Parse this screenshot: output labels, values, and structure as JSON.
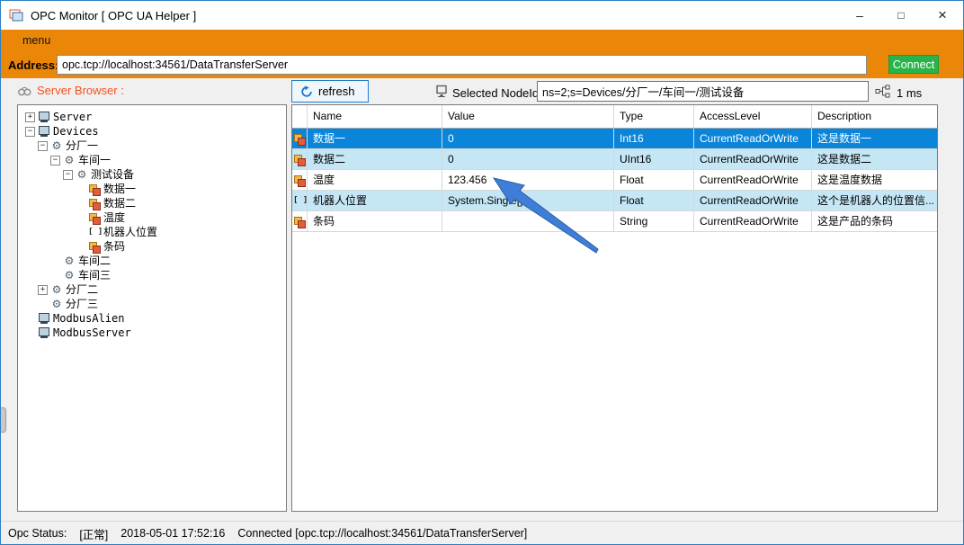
{
  "window": {
    "title": "OPC Monitor [ OPC UA Helper ]"
  },
  "icons": {
    "minimize": "–",
    "maximize": "□",
    "close": "×",
    "expander_collapsed": "+",
    "expander_expanded": "−",
    "gear": "⚙",
    "array": "[ ]"
  },
  "menubar": {
    "menu_label": "menu"
  },
  "address": {
    "label": "Address:",
    "value": "opc.tcp://localhost:34561/DataTransferServer",
    "connect_label": "Connect"
  },
  "browser": {
    "label": "Server Browser :",
    "tree": [
      {
        "label": "Server",
        "level": 0,
        "expander": "plus",
        "icon": "server"
      },
      {
        "label": "Devices",
        "level": 0,
        "expander": "minus",
        "icon": "server"
      },
      {
        "label": "分厂一",
        "level": 1,
        "expander": "minus",
        "icon": "gear"
      },
      {
        "label": "车间一",
        "level": 2,
        "expander": "minus",
        "icon": "gear"
      },
      {
        "label": "测试设备",
        "level": 3,
        "expander": "minus",
        "icon": "gear"
      },
      {
        "label": "数据一",
        "level": 4,
        "expander": "none",
        "icon": "tag"
      },
      {
        "label": "数据二",
        "level": 4,
        "expander": "none",
        "icon": "tag"
      },
      {
        "label": "温度",
        "level": 4,
        "expander": "none",
        "icon": "tag"
      },
      {
        "label": "机器人位置",
        "level": 4,
        "expander": "none",
        "icon": "array"
      },
      {
        "label": "条码",
        "level": 4,
        "expander": "none",
        "icon": "tag"
      },
      {
        "label": "车间二",
        "level": 2,
        "expander": "none",
        "icon": "gear"
      },
      {
        "label": "车间三",
        "level": 2,
        "expander": "none",
        "icon": "gear"
      },
      {
        "label": "分厂二",
        "level": 1,
        "expander": "plus",
        "icon": "gear"
      },
      {
        "label": "分厂三",
        "level": 1,
        "expander": "none",
        "icon": "gear"
      },
      {
        "label": "ModbusAlien",
        "level": 0,
        "expander": "none",
        "icon": "server"
      },
      {
        "label": "ModbusServer",
        "level": 0,
        "expander": "none",
        "icon": "server"
      }
    ]
  },
  "toolbar": {
    "refresh_label": "refresh",
    "nodeid_label": "Selected NodeId:",
    "nodeid_value": "ns=2;s=Devices/分厂一/车间一/测试设备",
    "latency": "1 ms"
  },
  "table": {
    "columns": [
      "Name",
      "Value",
      "Type",
      "AccessLevel",
      "Description"
    ],
    "rows": [
      {
        "name": "数据一",
        "value": "0",
        "type": "Int16",
        "access": "CurrentReadOrWrite",
        "description": "这是数据一",
        "icon": "tag",
        "state": "selected"
      },
      {
        "name": "数据二",
        "value": "0",
        "type": "UInt16",
        "access": "CurrentReadOrWrite",
        "description": "这是数据二",
        "icon": "tag",
        "state": "alt"
      },
      {
        "name": "温度",
        "value": "123.456",
        "type": "Float",
        "access": "CurrentReadOrWrite",
        "description": "这是温度数据",
        "icon": "tag",
        "state": "normal"
      },
      {
        "name": "机器人位置",
        "value": "System.Single[]",
        "type": "Float",
        "access": "CurrentReadOrWrite",
        "description": "这个是机器人的位置信...",
        "icon": "array",
        "state": "alt"
      },
      {
        "name": "条码",
        "value": "",
        "type": "String",
        "access": "CurrentReadOrWrite",
        "description": "这是产品的条码",
        "icon": "tag",
        "state": "normal"
      }
    ]
  },
  "statusbar": {
    "label": "Opc Status:",
    "state": "[正常]",
    "timestamp": "2018-05-01 17:52:16",
    "connection": "Connected [opc.tcp://localhost:34561/DataTransferServer]"
  },
  "colors": {
    "accent_orange": "#EA8608",
    "connect_green": "#29B44B",
    "selected_row_blue": "#0A85D9",
    "alt_row_blue": "#C4E6F5",
    "browser_label_orange": "#F4511E"
  }
}
